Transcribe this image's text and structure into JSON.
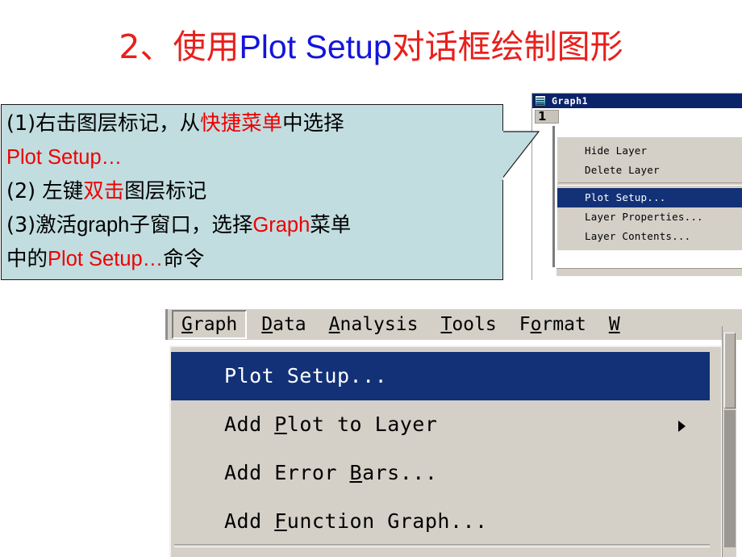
{
  "slide": {
    "title_parts": [
      {
        "text": "2、使用",
        "color": "red",
        "script": "cn"
      },
      {
        "text": "Plot Setup",
        "color": "blue",
        "script": "en"
      },
      {
        "text": "对话框绘制图形",
        "color": "red",
        "script": "cn"
      }
    ],
    "title_plain": "2、使用Plot Setup对话框绘制图形",
    "colors": {
      "red": "#e8201c",
      "blue": "#1414dc",
      "callout_bg": "#c2dde0",
      "menu_highlight": "#123177",
      "menu_face": "#d4d0c8",
      "titlebar": "#0a246a"
    }
  },
  "callout": {
    "lines": [
      [
        {
          "t": "(1)右击图层标记，从",
          "c": "black",
          "s": "cn"
        },
        {
          "t": "快捷菜单",
          "c": "red",
          "s": "cn"
        },
        {
          "t": "中选择",
          "c": "black",
          "s": "cn"
        }
      ],
      [
        {
          "t": "Plot Setup…",
          "c": "red",
          "s": "lat"
        }
      ],
      [
        {
          "t": "(2) 左键",
          "c": "black",
          "s": "cn"
        },
        {
          "t": "双击",
          "c": "red",
          "s": "cn"
        },
        {
          "t": "图层标记",
          "c": "black",
          "s": "cn"
        }
      ],
      [
        {
          "t": "(3)激活",
          "c": "black",
          "s": "cn"
        },
        {
          "t": "graph",
          "c": "black",
          "s": "lat"
        },
        {
          "t": "子窗口，选择",
          "c": "black",
          "s": "cn"
        },
        {
          "t": "Graph",
          "c": "red",
          "s": "lat"
        },
        {
          "t": "菜单",
          "c": "black",
          "s": "cn"
        }
      ],
      [
        {
          "t": "中的",
          "c": "black",
          "s": "cn"
        },
        {
          "t": "Plot Setup…",
          "c": "red",
          "s": "lat"
        },
        {
          "t": "命令",
          "c": "black",
          "s": "cn"
        }
      ]
    ]
  },
  "graph_window": {
    "title": "Graph1",
    "icon": "graph-window-icon",
    "layer_marker": "1"
  },
  "context_menu": {
    "items": [
      {
        "label": "Hide Layer",
        "selected": false,
        "separator_before": false
      },
      {
        "label": "Delete Layer",
        "selected": false,
        "separator_before": false
      },
      {
        "label": "Plot Setup...",
        "selected": true,
        "separator_before": true
      },
      {
        "label": "Layer Properties...",
        "selected": false,
        "separator_before": false
      },
      {
        "label": "Layer Contents...",
        "selected": false,
        "separator_before": false
      }
    ]
  },
  "menubar": {
    "items": [
      {
        "label": "Graph",
        "mnemonic": "G",
        "active": true
      },
      {
        "label": "Data",
        "mnemonic": "D",
        "active": false
      },
      {
        "label": "Analysis",
        "mnemonic": "A",
        "active": false
      },
      {
        "label": "Tools",
        "mnemonic": "T",
        "active": false
      },
      {
        "label": "Format",
        "mnemonic": "o",
        "active": false
      },
      {
        "label": "W",
        "mnemonic": "W",
        "active": false
      }
    ]
  },
  "dropdown": {
    "items": [
      {
        "label": "Plot Setup...",
        "mnemonic": "",
        "selected": true,
        "submenu": false
      },
      {
        "label": "Add Plot to Layer",
        "mnemonic": "P",
        "selected": false,
        "submenu": true
      },
      {
        "label": "Add Error Bars...",
        "mnemonic": "B",
        "selected": false,
        "submenu": false
      },
      {
        "label": "Add Function Graph...",
        "mnemonic": "F",
        "selected": false,
        "submenu": false
      }
    ]
  }
}
